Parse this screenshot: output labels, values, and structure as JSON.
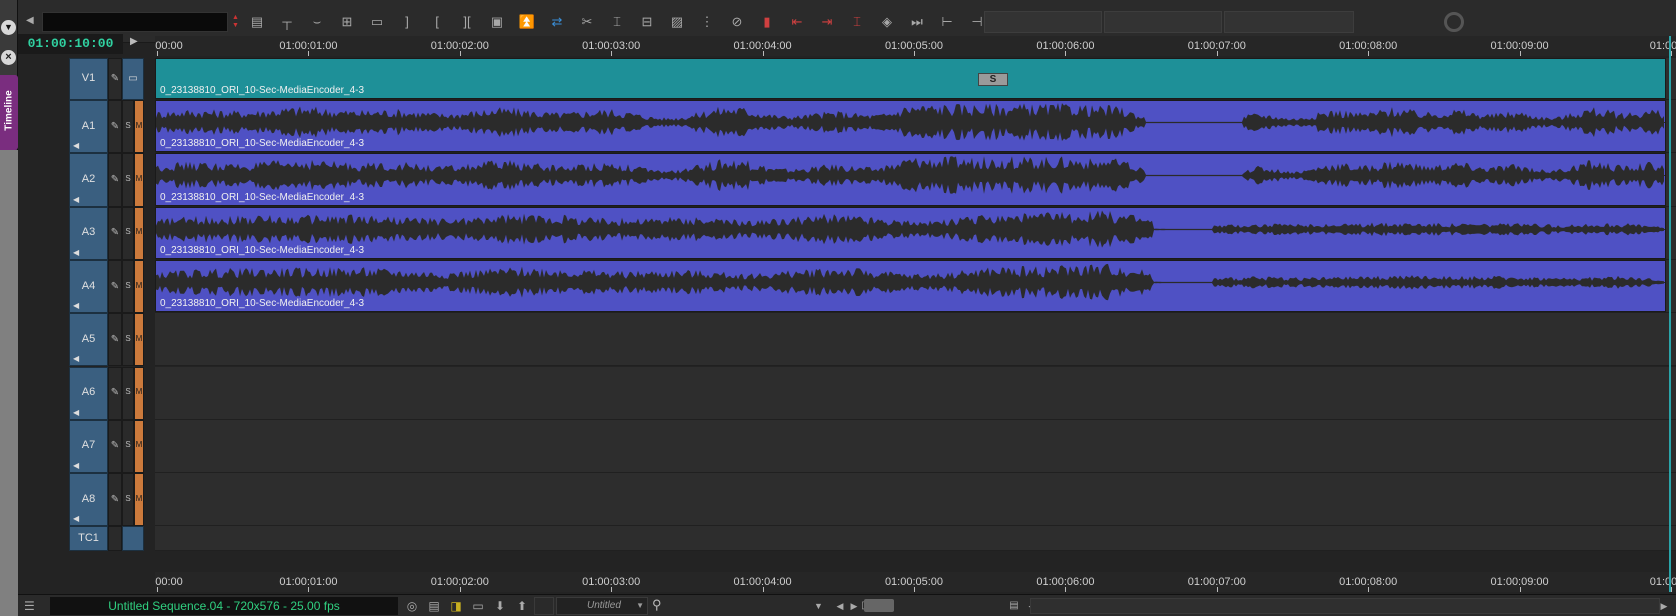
{
  "window": {
    "side_tab": "Timeline"
  },
  "toolbar": {
    "tools": [
      {
        "name": "track-menu-icon",
        "glyph": "▤",
        "color": ""
      },
      {
        "name": "lift-icon",
        "glyph": "┬",
        "color": ""
      },
      {
        "name": "extract-icon",
        "glyph": "⌣",
        "color": ""
      },
      {
        "name": "ripple-icon",
        "glyph": "⊞",
        "color": ""
      },
      {
        "name": "overwrite-icon",
        "glyph": "▭",
        "color": ""
      },
      {
        "name": "mark-out-icon",
        "glyph": "]",
        "color": ""
      },
      {
        "name": "mark-in-icon",
        "glyph": "[",
        "color": ""
      },
      {
        "name": "mark-clip-icon",
        "glyph": "][",
        "color": ""
      },
      {
        "name": "clear-marks-icon",
        "glyph": "▣",
        "color": ""
      },
      {
        "name": "lift-segment-icon",
        "glyph": "⏫",
        "color": ""
      },
      {
        "name": "splice-in-icon",
        "glyph": "⇄",
        "color": "blue"
      },
      {
        "name": "cut-icon",
        "glyph": "✂",
        "color": ""
      },
      {
        "name": "trim-icon",
        "glyph": "⌶",
        "color": ""
      },
      {
        "name": "segment-mode-icon",
        "glyph": "⊟",
        "color": ""
      },
      {
        "name": "effect-icon",
        "glyph": "▨",
        "color": ""
      },
      {
        "name": "sync-icon",
        "glyph": "⋮",
        "color": ""
      },
      {
        "name": "disable-icon",
        "glyph": "⊘",
        "color": ""
      },
      {
        "name": "record-mark-icon",
        "glyph": "▮",
        "color": "red"
      },
      {
        "name": "go-to-in-icon",
        "glyph": "⇤",
        "color": "red"
      },
      {
        "name": "go-to-out-icon",
        "glyph": "⇥",
        "color": "red"
      },
      {
        "name": "mark-range-icon",
        "glyph": "⌶",
        "color": "red"
      },
      {
        "name": "audio-scrub-icon",
        "glyph": "◈",
        "color": ""
      },
      {
        "name": "play-to-end-icon",
        "glyph": "⏭",
        "color": ""
      },
      {
        "name": "trim-left-icon",
        "glyph": "⊢",
        "color": ""
      },
      {
        "name": "trim-right-icon",
        "glyph": "⊣",
        "color": ""
      }
    ]
  },
  "timecode": {
    "current": "01:00:10:00"
  },
  "ruler": {
    "labels": [
      "00:00",
      "01:00:01:00",
      "01:00:02:00",
      "01:00:03:00",
      "01:00:04:00",
      "01:00:05:00",
      "01:00:06:00",
      "01:00:07:00",
      "01:00:08:00",
      "01:00:09:00",
      "01:00:"
    ]
  },
  "tracks": [
    {
      "name": "V1",
      "type": "video",
      "clip": "0_23138810_ORI_10-Sec-MediaEncoder_4-3"
    },
    {
      "name": "A1",
      "type": "audio",
      "s": "S",
      "m": "M",
      "clip": "0_23138810_ORI_10-Sec-MediaEncoder_4-3",
      "wave": "a"
    },
    {
      "name": "A2",
      "type": "audio",
      "s": "S",
      "m": "M",
      "clip": "0_23138810_ORI_10-Sec-MediaEncoder_4-3",
      "wave": "a"
    },
    {
      "name": "A3",
      "type": "audio",
      "s": "S",
      "m": "M",
      "clip": "0_23138810_ORI_10-Sec-MediaEncoder_4-3",
      "wave": "b"
    },
    {
      "name": "A4",
      "type": "audio",
      "s": "S",
      "m": "M",
      "clip": "0_23138810_ORI_10-Sec-MediaEncoder_4-3",
      "wave": "b"
    },
    {
      "name": "A5",
      "type": "audio",
      "s": "S",
      "m": "M",
      "clip": ""
    },
    {
      "name": "A6",
      "type": "audio",
      "s": "S",
      "m": "M",
      "clip": ""
    },
    {
      "name": "A7",
      "type": "audio",
      "s": "S",
      "m": "M",
      "clip": ""
    },
    {
      "name": "A8",
      "type": "audio",
      "s": "S",
      "m": "M",
      "clip": ""
    },
    {
      "name": "TC1",
      "type": "timecode",
      "clip": ""
    }
  ],
  "snap_marker": "S",
  "statusbar": {
    "sequence_info": "Untitled Sequence.04 - 720x576 - 25.00 fps",
    "bin_select": "Untitled",
    "search_placeholder": ""
  },
  "colors": {
    "video_clip": "#1e9098",
    "audio_clip": "#4f51c4",
    "timecode_text": "#30d0a0",
    "sequence_text": "#30d080",
    "mute_button": "#cc7a3c",
    "track_header": "#3a5f80",
    "side_tab": "#7a2d7f"
  }
}
